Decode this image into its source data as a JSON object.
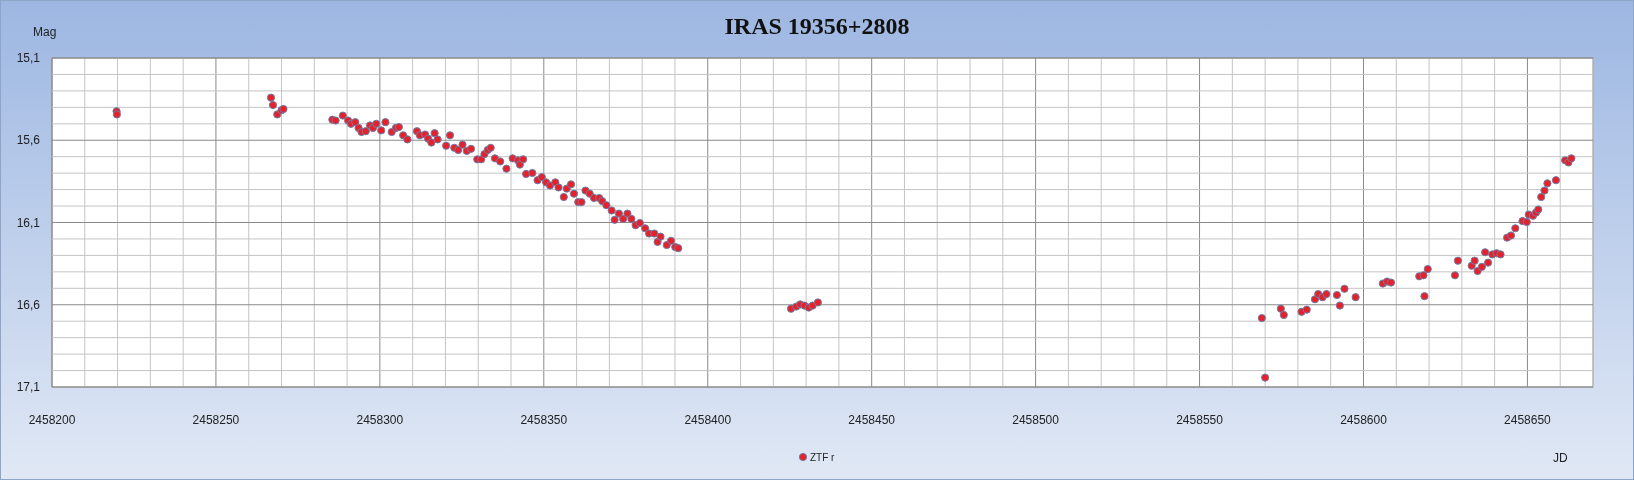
{
  "chart": {
    "chart_data": {
      "type": "scatter",
      "title": "IRAS 19356+2808",
      "xlabel": "JD",
      "ylabel": "Mag",
      "x": [
        2458219.7,
        2458219.8,
        2458266.8,
        2458267.4,
        2458268.7,
        2458270.0,
        2458270.6,
        2458285.5,
        2458286.5,
        2458288.7,
        2458290.3,
        2458291.2,
        2458292.5,
        2458293.5,
        2458294.4,
        2458295.7,
        2458297.0,
        2458297.9,
        2458298.9,
        2458300.4,
        2458301.7,
        2458303.6,
        2458304.9,
        2458305.8,
        2458307.1,
        2458308.4,
        2458311.3,
        2458312.2,
        2458313.8,
        2458314.7,
        2458315.7,
        2458316.7,
        2458317.6,
        2458320.2,
        2458321.4,
        2458322.7,
        2458323.9,
        2458325.2,
        2458326.5,
        2458327.8,
        2458329.7,
        2458330.9,
        2458331.9,
        2458332.9,
        2458333.8,
        2458335.1,
        2458336.7,
        2458338.6,
        2458340.5,
        2458342.1,
        2458342.7,
        2458343.7,
        2458344.6,
        2458346.5,
        2458348.1,
        2458349.4,
        2458350.7,
        2458351.9,
        2458353.5,
        2458354.5,
        2458356.1,
        2458357.0,
        2458358.3,
        2458359.2,
        2458360.5,
        2458361.5,
        2458362.7,
        2458364.0,
        2458365.3,
        2458366.9,
        2458367.8,
        2458369.1,
        2458370.7,
        2458371.6,
        2458372.9,
        2458374.2,
        2458375.5,
        2458376.7,
        2458378.0,
        2458379.3,
        2458380.9,
        2458382.1,
        2458383.7,
        2458384.7,
        2458385.6,
        2458387.5,
        2458388.8,
        2458390.1,
        2458391.0,
        2458425.4,
        2458427.0,
        2458428.2,
        2458429.5,
        2458430.8,
        2458432.0,
        2458433.6,
        2458569.0,
        2458570.0,
        2458574.8,
        2458575.7,
        2458581.1,
        2458582.7,
        2458585.2,
        2458586.2,
        2458587.5,
        2458588.7,
        2458591.9,
        2458592.8,
        2458594.2,
        2458597.6,
        2458605.9,
        2458607.2,
        2458608.4,
        2458617.0,
        2458618.3,
        2458618.6,
        2458619.6,
        2458627.9,
        2458628.8,
        2458633.0,
        2458633.9,
        2458634.8,
        2458636.1,
        2458637.1,
        2458638.0,
        2458639.3,
        2458640.6,
        2458641.8,
        2458643.8,
        2458645.0,
        2458646.3,
        2458648.5,
        2458649.8,
        2458650.4,
        2458651.7,
        2458652.6,
        2458653.3,
        2458654.2,
        2458655.2,
        2458656.1,
        2458658.7,
        2458661.5,
        2458662.5,
        2458663.4
      ],
      "series": [
        {
          "name": "ZTF r",
          "color": "#e8202a",
          "values": [
            15.424,
            15.443,
            15.341,
            15.386,
            15.443,
            15.417,
            15.41,
            15.475,
            15.48,
            15.45,
            15.48,
            15.5,
            15.49,
            15.525,
            15.55,
            15.545,
            15.51,
            15.525,
            15.5,
            15.54,
            15.49,
            15.55,
            15.525,
            15.52,
            15.57,
            15.595,
            15.545,
            15.57,
            15.565,
            15.59,
            15.614,
            15.557,
            15.595,
            15.633,
            15.57,
            15.646,
            15.659,
            15.627,
            15.665,
            15.652,
            15.716,
            15.716,
            15.684,
            15.659,
            15.646,
            15.71,
            15.729,
            15.773,
            15.71,
            15.722,
            15.748,
            15.716,
            15.805,
            15.799,
            15.843,
            15.824,
            15.856,
            15.875,
            15.856,
            15.887,
            15.945,
            15.894,
            15.868,
            15.925,
            15.976,
            15.976,
            15.906,
            15.925,
            15.951,
            15.951,
            15.97,
            15.995,
            16.027,
            16.084,
            16.046,
            16.078,
            16.046,
            16.078,
            16.116,
            16.103,
            16.135,
            16.167,
            16.167,
            16.218,
            16.186,
            16.237,
            16.211,
            16.249,
            16.256,
            16.624,
            16.611,
            16.598,
            16.605,
            16.617,
            16.605,
            16.586,
            16.681,
            17.043,
            16.624,
            16.662,
            16.643,
            16.63,
            16.567,
            16.535,
            16.554,
            16.535,
            16.541,
            16.605,
            16.503,
            16.554,
            16.471,
            16.459,
            16.465,
            16.427,
            16.421,
            16.548,
            16.383,
            16.421,
            16.332,
            16.363,
            16.332,
            16.395,
            16.37,
            16.281,
            16.344,
            16.294,
            16.287,
            16.294,
            16.192,
            16.179,
            16.135,
            16.091,
            16.097,
            16.052,
            16.059,
            16.04,
            16.021,
            15.945,
            15.906,
            15.862,
            15.843,
            15.722,
            15.735,
            15.71
          ]
        }
      ],
      "xlim": [
        2458200,
        2458670
      ],
      "ylim": [
        17.1,
        15.1
      ],
      "grid": true,
      "xticks": [
        2458200,
        2458250,
        2458300,
        2458350,
        2458400,
        2458450,
        2458500,
        2458550,
        2458600,
        2458650
      ],
      "yticks": [
        {
          "value": 15.1,
          "label": "15,1"
        },
        {
          "value": 15.6,
          "label": "15,6"
        },
        {
          "value": 16.1,
          "label": "16,1"
        },
        {
          "value": 16.6,
          "label": "16,6"
        },
        {
          "value": 17.1,
          "label": "17,1"
        }
      ]
    }
  }
}
